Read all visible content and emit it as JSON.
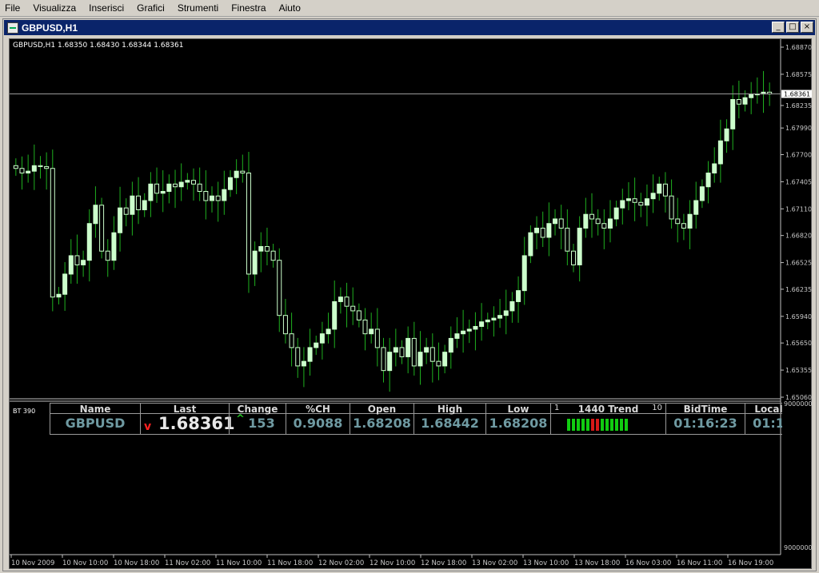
{
  "menu": [
    "File",
    "Visualizza",
    "Inserisci",
    "Grafici",
    "Strumenti",
    "Finestra",
    "Aiuto"
  ],
  "window": {
    "title": "GBPUSD,H1",
    "buttons": [
      "_",
      "□",
      "×"
    ]
  },
  "chart": {
    "info_label": "GBPUSD,H1  1.68350 1.68430 1.68344 1.68361",
    "current_price_label": "1.68361",
    "subwindow_label": "BT 390",
    "sub_axis_top": "9000000",
    "sub_axis_bottom": "9000000",
    "colors": {
      "background": "#000000",
      "candle": "#ccffcc",
      "wick": "#1fb01f",
      "grid_axis": "#c0c0c0",
      "current_price_line": "#9a9a9a"
    }
  },
  "chart_data": {
    "type": "candlestick",
    "symbol": "GBPUSD",
    "timeframe": "H1",
    "ylim": [
      1.6506,
      1.6887
    ],
    "y_ticks": [
      "1.68870",
      "1.68575",
      "1.68235",
      "1.67990",
      "1.67700",
      "1.67405",
      "1.67110",
      "1.66820",
      "1.66525",
      "1.66235",
      "1.65940",
      "1.65650",
      "1.65355",
      "1.65060"
    ],
    "x_ticks": [
      "10 Nov 2009",
      "10 Nov 10:00",
      "10 Nov 18:00",
      "11 Nov 02:00",
      "11 Nov 10:00",
      "11 Nov 18:00",
      "12 Nov 02:00",
      "12 Nov 10:00",
      "12 Nov 18:00",
      "13 Nov 02:00",
      "13 Nov 10:00",
      "13 Nov 18:00",
      "16 Nov 03:00",
      "16 Nov 11:00",
      "16 Nov 19:00"
    ],
    "current_price": 1.68361,
    "close_values": [
      1.6755,
      1.675,
      1.6752,
      1.6758,
      1.6757,
      1.6755,
      1.6615,
      1.6618,
      1.664,
      1.666,
      1.665,
      1.6655,
      1.6695,
      1.6715,
      1.6665,
      1.6655,
      1.6685,
      1.6712,
      1.6705,
      1.6725,
      1.671,
      1.672,
      1.6738,
      1.6728,
      1.673,
      1.6738,
      1.6735,
      1.674,
      1.6742,
      1.6738,
      1.673,
      1.672,
      1.6725,
      1.672,
      1.6732,
      1.6745,
      1.6752,
      1.675,
      1.664,
      1.6665,
      1.667,
      1.6665,
      1.6655,
      1.6595,
      1.6575,
      1.656,
      1.654,
      1.6545,
      1.656,
      1.6565,
      1.6575,
      1.658,
      1.661,
      1.6615,
      1.6605,
      1.66,
      1.659,
      1.6575,
      1.658,
      1.656,
      1.6535,
      1.6555,
      1.656,
      1.655,
      1.657,
      1.654,
      1.6555,
      1.656,
      1.6545,
      1.654,
      1.6555,
      1.657,
      1.6575,
      1.6578,
      1.658,
      1.6583,
      1.6588,
      1.659,
      1.6592,
      1.6595,
      1.66,
      1.661,
      1.6622,
      1.666,
      1.6685,
      1.669,
      1.668,
      1.6695,
      1.67,
      1.669,
      1.6665,
      1.665,
      1.669,
      1.6705,
      1.67,
      1.6695,
      1.669,
      1.67,
      1.6712,
      1.672,
      1.6722,
      1.6718,
      1.6715,
      1.6722,
      1.6728,
      1.6738,
      1.6725,
      1.67,
      1.6695,
      1.669,
      1.6705,
      1.672,
      1.6735,
      1.675,
      1.676,
      1.6785,
      1.6798,
      1.683,
      1.6825,
      1.6832,
      1.6836,
      1.6836,
      1.6838,
      1.6836
    ],
    "ticker": {
      "columns": [
        "Name",
        "Last",
        "Change",
        "%CH",
        "Open",
        "High",
        "Low",
        "1440 Trend",
        "BidTime",
        "Local"
      ],
      "values": {
        "name": "GBPUSD",
        "last": "1.68361",
        "change": "153",
        "pct_change": "0.9088",
        "open": "1.68208",
        "high": "1.68442",
        "low": "1.68208",
        "bidtime": "01:16:23",
        "local": "01:1"
      },
      "last_direction": "v",
      "change_direction": "^",
      "trend_scale_min": "1",
      "trend_scale_max": "10",
      "trend_bars": [
        "green",
        "green",
        "green",
        "green",
        "green",
        "red",
        "red",
        "green",
        "green",
        "green",
        "green",
        "green",
        "green"
      ]
    }
  }
}
